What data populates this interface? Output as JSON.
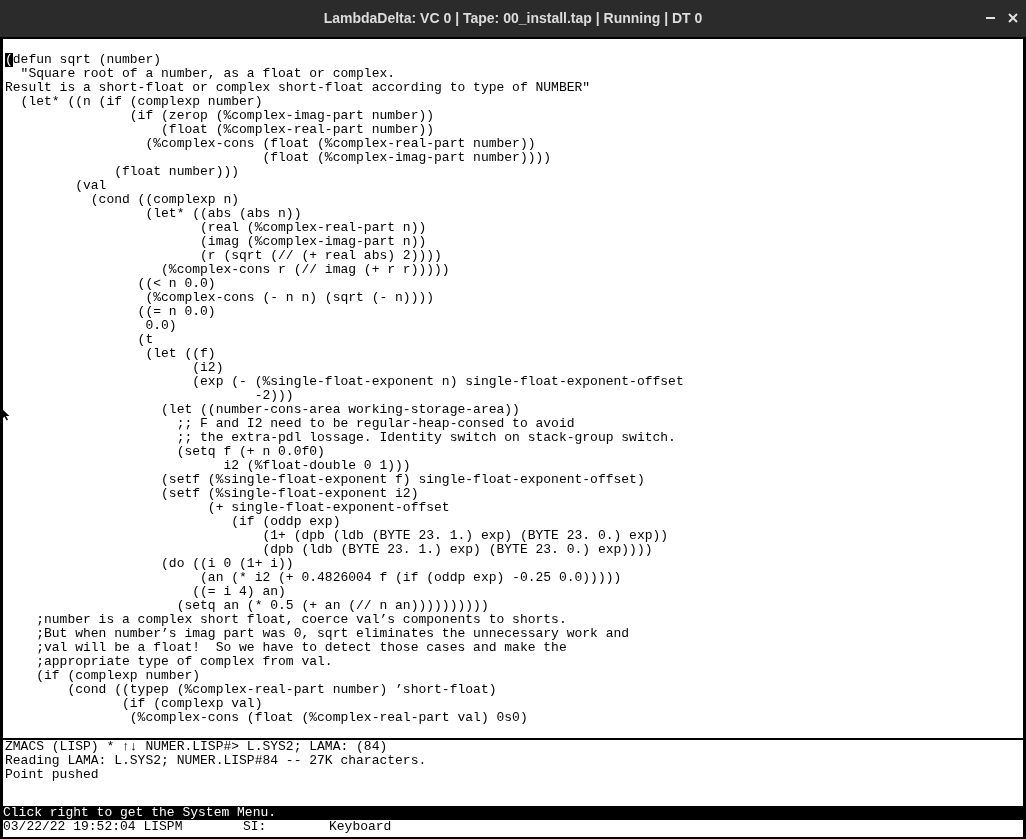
{
  "window": {
    "title": "LambdaDelta: VC 0 | Tape: 00_install.tap | Running | DT 0"
  },
  "editor": {
    "lines": [
      {
        "text": "(defun sqrt (number)",
        "cursor": true
      },
      {
        "text": "  \"Square root of a number, as a float or complex.",
        "cursor": false
      },
      {
        "text": "Result is a short-float or complex short-float according to type of NUMBER\"",
        "cursor": false
      },
      {
        "text": "  (let* ((n (if (complexp number)",
        "cursor": false
      },
      {
        "text": "                (if (zerop (%complex-imag-part number))",
        "cursor": false
      },
      {
        "text": "                    (float (%complex-real-part number))",
        "cursor": false
      },
      {
        "text": "                  (%complex-cons (float (%complex-real-part number))",
        "cursor": false
      },
      {
        "text": "                                 (float (%complex-imag-part number))))",
        "cursor": false
      },
      {
        "text": "              (float number)))",
        "cursor": false
      },
      {
        "text": "         (val",
        "cursor": false
      },
      {
        "text": "           (cond ((complexp n)",
        "cursor": false
      },
      {
        "text": "                  (let* ((abs (abs n))",
        "cursor": false
      },
      {
        "text": "                         (real (%complex-real-part n))",
        "cursor": false
      },
      {
        "text": "                         (imag (%complex-imag-part n))",
        "cursor": false
      },
      {
        "text": "                         (r (sqrt (// (+ real abs) 2))))",
        "cursor": false
      },
      {
        "text": "                    (%complex-cons r (// imag (+ r r)))))",
        "cursor": false
      },
      {
        "text": "                 ((< n 0.0)",
        "cursor": false
      },
      {
        "text": "                  (%complex-cons (- n n) (sqrt (- n))))",
        "cursor": false
      },
      {
        "text": "                 ((= n 0.0)",
        "cursor": false
      },
      {
        "text": "                  0.0)",
        "cursor": false
      },
      {
        "text": "                 (t",
        "cursor": false
      },
      {
        "text": "                  (let ((f)",
        "cursor": false
      },
      {
        "text": "                        (i2)",
        "cursor": false
      },
      {
        "text": "                        (exp (- (%single-float-exponent n) single-float-exponent-offset",
        "cursor": false
      },
      {
        "text": "                                -2)))",
        "cursor": false
      },
      {
        "text": "                    (let ((number-cons-area working-storage-area))",
        "cursor": false
      },
      {
        "text": "                      ;; F and I2 need to be regular-heap-consed to avoid",
        "cursor": false
      },
      {
        "text": "                      ;; the extra-pdl lossage. Identity switch on stack-group switch.",
        "cursor": false
      },
      {
        "text": "                      (setq f (+ n 0.0f0)",
        "cursor": false
      },
      {
        "text": "                            i2 (%float-double 0 1)))",
        "cursor": false
      },
      {
        "text": "                    (setf (%single-float-exponent f) single-float-exponent-offset)",
        "cursor": false
      },
      {
        "text": "                    (setf (%single-float-exponent i2)",
        "cursor": false
      },
      {
        "text": "                          (+ single-float-exponent-offset",
        "cursor": false
      },
      {
        "text": "                             (if (oddp exp)",
        "cursor": false
      },
      {
        "text": "                                 (1+ (dpb (ldb (BYTE 23. 1.) exp) (BYTE 23. 0.) exp))",
        "cursor": false
      },
      {
        "text": "                                 (dpb (ldb (BYTE 23. 1.) exp) (BYTE 23. 0.) exp))))",
        "cursor": false
      },
      {
        "text": "                    (do ((i 0 (1+ i))",
        "cursor": false
      },
      {
        "text": "                         (an (* i2 (+ 0.4826004 f (if (oddp exp) -0.25 0.0)))))",
        "cursor": false
      },
      {
        "text": "                        ((= i 4) an)",
        "cursor": false
      },
      {
        "text": "                      (setq an (* 0.5 (+ an (// n an))))))))))",
        "cursor": false
      },
      {
        "text": "    ;number is a complex short float, coerce val’s components to shorts.",
        "cursor": false
      },
      {
        "text": "    ;But when number’s imag part was 0, sqrt eliminates the unnecessary work and",
        "cursor": false
      },
      {
        "text": "    ;val will be a float!  So we have to detect those cases and make the",
        "cursor": false
      },
      {
        "text": "    ;appropriate type of complex from val.",
        "cursor": false
      },
      {
        "text": "    (if (complexp number)",
        "cursor": false
      },
      {
        "text": "        (cond ((typep (%complex-real-part number) ’short-float)",
        "cursor": false
      },
      {
        "text": "               (if (complexp val)",
        "cursor": false
      },
      {
        "text": "                (%complex-cons (float (%complex-real-part val) 0s0)",
        "cursor": false
      }
    ]
  },
  "mode_line": "ZMACS (LISP) * ↑↓ NUMER.LISP#> L.SYS2; LAMA: (84)",
  "echo_area": [
    "Reading LAMA: L.SYS2; NUMER.LISP#84 -- 27K characters.",
    "Point pushed"
  ],
  "mouse_documentation": "Click right to get the System Menu.",
  "status_line": {
    "date_time_host": "03/22/22 19:52:04 LISPM",
    "package": "SI:",
    "state": "Keyboard"
  }
}
